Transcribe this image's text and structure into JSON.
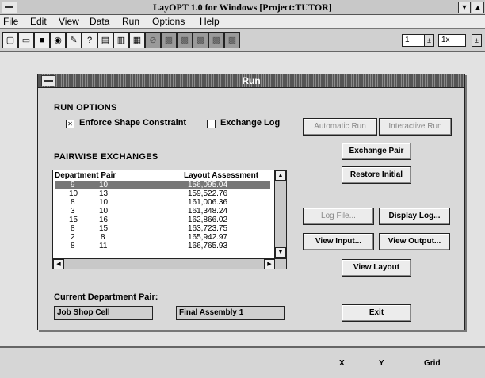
{
  "window": {
    "title": "LayOPT 1.0 for Windows [Project:TUTOR]",
    "minimize_glyph": "▼",
    "maximize_glyph": "▲"
  },
  "menu": [
    "File",
    "Edit",
    "View",
    "Data",
    "Run",
    "Options",
    "Help"
  ],
  "toolbar": {
    "icons": [
      "new-file-icon",
      "open-folder-icon",
      "save-disk-icon",
      "view-icon",
      "tools-icon",
      "help-icon",
      "layout-icon",
      "chart-icon",
      "print-icon",
      "disabled-icon-1",
      "disabled-icon-2",
      "disabled-icon-3",
      "disabled-icon-4",
      "disabled-icon-5",
      "disabled-icon-6"
    ],
    "field1_value": "1",
    "field2_value": "1x",
    "spin_glyph": "±"
  },
  "dialog": {
    "title": "Run",
    "run_options_label": "RUN OPTIONS",
    "enforce_shape_label": "Enforce Shape Constraint",
    "enforce_shape_checked": true,
    "exchange_log_label": "Exchange Log",
    "exchange_log_checked": false,
    "pairwise_label": "PAIRWISE EXCHANGES",
    "list_headers": {
      "dept": "Department Pair",
      "assessment": "Layout Assessment"
    },
    "rows": [
      {
        "a": "9",
        "b": "10",
        "v": "156,095.04",
        "selected": true
      },
      {
        "a": "10",
        "b": "13",
        "v": "159,522.76"
      },
      {
        "a": "8",
        "b": "10",
        "v": "161,006.36"
      },
      {
        "a": "3",
        "b": "10",
        "v": "161,348.24"
      },
      {
        "a": "15",
        "b": "16",
        "v": "162,866.02"
      },
      {
        "a": "8",
        "b": "15",
        "v": "163,723.75"
      },
      {
        "a": "2",
        "b": "8",
        "v": "165,942.97"
      },
      {
        "a": "8",
        "b": "11",
        "v": "166,765.93"
      }
    ],
    "current_pair_label": "Current Department Pair:",
    "current_pair_1": "Job Shop Cell",
    "current_pair_2": "Final Assembly 1",
    "buttons": {
      "automatic_run": "Automatic Run",
      "interactive_run": "Interactive Run",
      "exchange_pair": "Exchange Pair",
      "restore_initial": "Restore Initial",
      "log_file": "Log File...",
      "display_log": "Display Log...",
      "view_input": "View Input...",
      "view_output": "View Output...",
      "view_layout": "View Layout",
      "exit": "Exit"
    }
  },
  "status": {
    "x": "X",
    "y": "Y",
    "grid": "Grid"
  }
}
